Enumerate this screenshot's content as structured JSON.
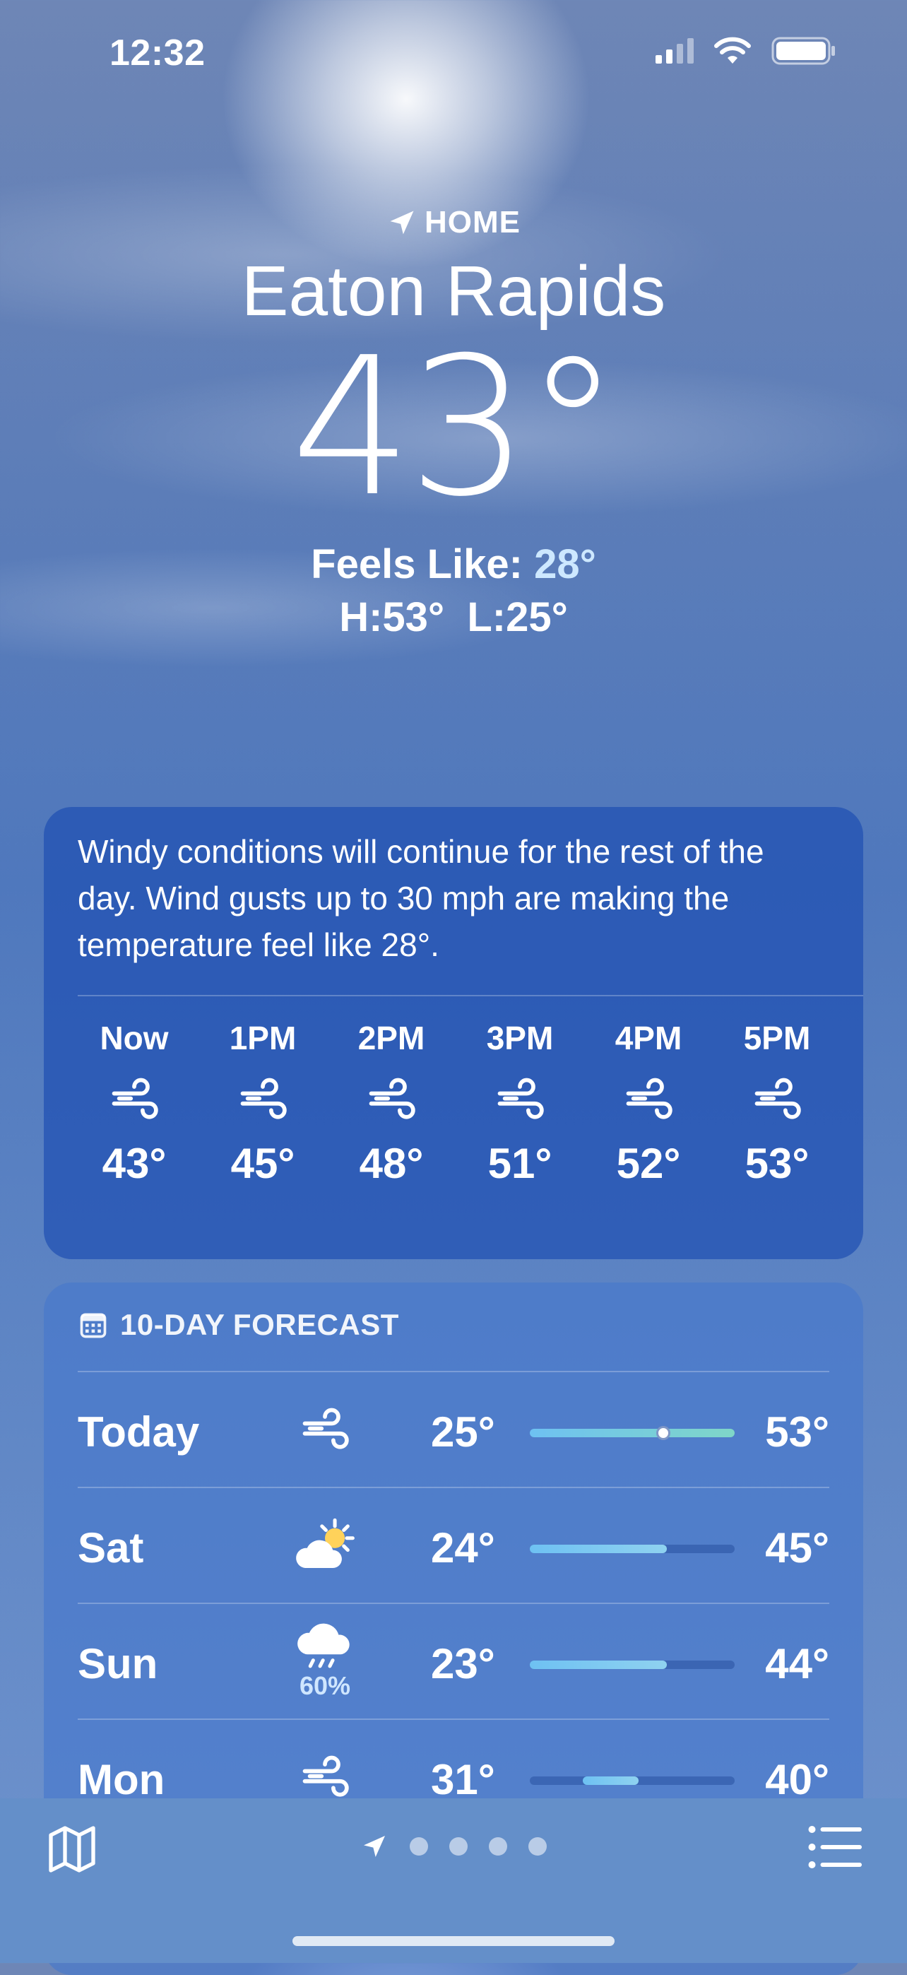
{
  "status_bar": {
    "time": "12:32",
    "icons": [
      "signal-icon",
      "wifi-icon",
      "battery-icon"
    ]
  },
  "location": {
    "label": "HOME",
    "city": "Eaton Rapids"
  },
  "current": {
    "temperature": "43°",
    "feels_like_label": "Feels Like: ",
    "feels_like_value": "28°",
    "high_low": "H:53°  L:25°"
  },
  "hourly": {
    "summary": "Windy conditions will continue for the rest of the day. Wind gusts up to 30 mph are making the temperature feel like 28°.",
    "items": [
      {
        "time": "Now",
        "icon": "wind-icon",
        "temp": "43°"
      },
      {
        "time": "1PM",
        "icon": "wind-icon",
        "temp": "45°"
      },
      {
        "time": "2PM",
        "icon": "wind-icon",
        "temp": "48°"
      },
      {
        "time": "3PM",
        "icon": "wind-icon",
        "temp": "51°"
      },
      {
        "time": "4PM",
        "icon": "wind-icon",
        "temp": "52°"
      },
      {
        "time": "5PM",
        "icon": "wind-icon",
        "temp": "53°"
      }
    ]
  },
  "forecast": {
    "title": "10-DAY FORECAST",
    "icon": "calendar-icon",
    "days": [
      {
        "day": "Today",
        "icon": "wind-icon",
        "precip": "",
        "low": "25°",
        "high": "53°",
        "range_start": 0.0,
        "range_end": 1.0,
        "current_position": 0.65
      },
      {
        "day": "Sat",
        "icon": "partly-sunny-icon",
        "precip": "",
        "low": "24°",
        "high": "45°",
        "range_start": 0.0,
        "range_end": 0.67
      },
      {
        "day": "Sun",
        "icon": "rain-cloud-icon",
        "precip": "60%",
        "low": "23°",
        "high": "44°",
        "range_start": 0.0,
        "range_end": 0.67
      },
      {
        "day": "Mon",
        "icon": "wind-icon",
        "precip": "",
        "low": "31°",
        "high": "40°",
        "range_start": 0.26,
        "range_end": 0.53
      }
    ]
  },
  "toolbar": {
    "left_icon": "map-icon",
    "right_icon": "list-icon",
    "page_dots": 4
  }
}
